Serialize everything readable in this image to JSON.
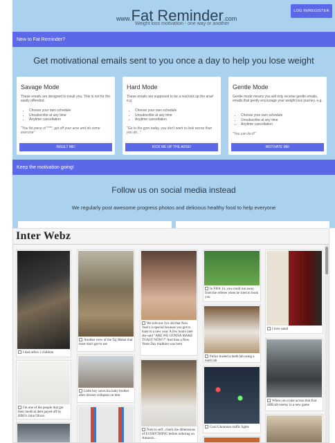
{
  "header": {
    "logo_prefix": "www.",
    "logo_main": "Fat Reminder",
    "logo_suffix": ".com",
    "tagline": "Weight loss motivation - one way or another",
    "login_label": "LOG IN/REGISTER"
  },
  "intro": {
    "band_label": "New to Fat Reminder?",
    "headline": "Get motivational emails sent to you once a day to help you lose weight"
  },
  "cards": [
    {
      "title": "Savage Mode",
      "description": "These emails are designed to insult you. This is not for the easily offended.",
      "features": [
        "Choose your own schedule",
        "Unsubscribe at any time",
        "Anytime cancellation"
      ],
      "quote": "\"You fat piece of ****, get off your arse and do some exercise\"",
      "button": "INSULT ME!"
    },
    {
      "title": "Hard Mode",
      "description": "These emails are supposed to be a real kick up the arse! e.g.",
      "features": [
        "Choose your own schedule",
        "Unsubscribe at any time",
        "Anytime cancellation"
      ],
      "quote": "\"Go to the gym today, you don't want to look worse than you do...\"",
      "button": "KICK ME UP THE ARSE!"
    },
    {
      "title": "Gentle Mode",
      "description": "Gentle mode means you will only receive gentle emails, emails that gently encourage your weight loss journey, e.g.",
      "features": [
        "Choose your own schedule",
        "Unsubscribe at any time",
        "Anytime cancellation"
      ],
      "quote": "\"You can do it!\"",
      "button": "MOTIVATE ME!"
    }
  ],
  "social": {
    "band_label": "Keep the motivation going!",
    "headline": "Follow us on social media instead",
    "subline": "We regularly post awesome progress photos and delicious healthy food to help everyone"
  },
  "widget": {
    "title": "Inter Webz",
    "posts": [
      {
        "caption": "I dad reflex 2 children"
      },
      {
        "caption": "I'm one of the people that got their medical debt payed off by HBO's John Oliver."
      },
      {
        "caption": "Another view of the Taj Mahal that most don't get to see"
      },
      {
        "caption": "Little boy saves his baby brother after dresser collapses on him"
      },
      {
        "caption": "We told our 3yo old that New Year's is special because you get to toast to a new year. A few hours later she said \"ARE WE GONNA MAKE TOAST NOW?!\" And thus a New Years Day tradition was born"
      },
      {
        "caption": "Note to self...check the dimensions of EVERYTHING before ordering on Amazon..."
      },
      {
        "caption": "In FIFA 14, you could run away from the referee when he tried to book you"
      },
      {
        "caption": "Police busted a meth lab using a meth lab"
      },
      {
        "caption": "Cool Ukrainian traffic lights"
      },
      {
        "caption": "I love satail"
      },
      {
        "caption": "When you come across that first difficult enemy in a new game"
      }
    ]
  },
  "colors": {
    "page_background": "#aad2ef",
    "accent": "#5b68e8"
  }
}
